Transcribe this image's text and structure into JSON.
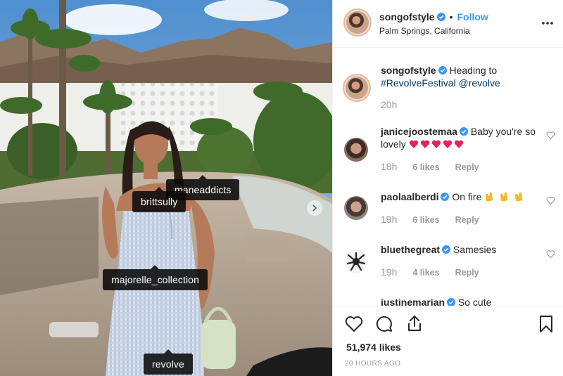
{
  "post": {
    "username": "songofstyle",
    "follow_label": "Follow",
    "location": "Palm Springs, California"
  },
  "photo_tags": [
    {
      "label": "maneaddicts"
    },
    {
      "label": "brittsully"
    },
    {
      "label": "majorelle_collection"
    },
    {
      "label": "revolve"
    }
  ],
  "caption": {
    "username": "songofstyle",
    "text_line1": "Heading to",
    "text_line2": "#RevolveFestival @revolve",
    "time": "20h"
  },
  "comments": [
    {
      "username": "janicejoostemaa",
      "text": "Baby you're so",
      "text2": "lovely",
      "emoji": "red-heart x5",
      "time": "18h",
      "likes": "6 likes",
      "reply": "Reply"
    },
    {
      "username": "paolaalberdi",
      "text": "On fire",
      "emoji": "clapping-hands x3",
      "time": "19h",
      "likes": "6 likes",
      "reply": "Reply"
    },
    {
      "username": "bluethegreat",
      "text": "Samesies",
      "time": "19h",
      "likes": "4 likes",
      "reply": "Reply"
    },
    {
      "username": "justinemarian",
      "text": "So cute"
    }
  ],
  "footer": {
    "likes": "51,974 likes",
    "time_ago": "20 HOURS AGO"
  },
  "colors": {
    "accent": "#3897f0",
    "verified": "#3897f0",
    "muted": "#999999"
  }
}
